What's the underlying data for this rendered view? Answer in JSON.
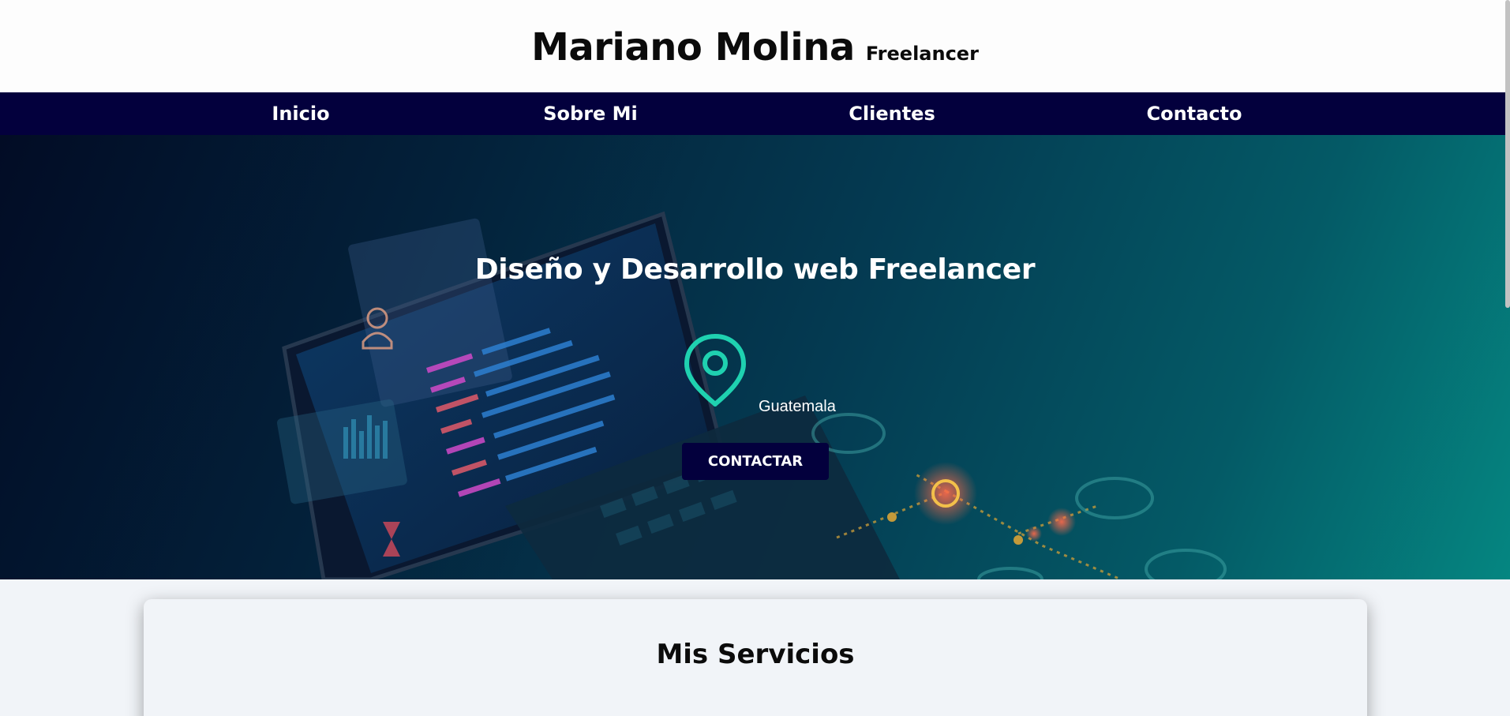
{
  "header": {
    "name": "Mariano Molina",
    "tagline": "Freelancer"
  },
  "nav": {
    "items": [
      {
        "label": "Inicio"
      },
      {
        "label": "Sobre Mi"
      },
      {
        "label": "Clientes"
      },
      {
        "label": "Contacto"
      }
    ]
  },
  "hero": {
    "title": "Diseño y Desarrollo web Freelancer",
    "location": "Guatemala",
    "location_icon": "map-pin-icon",
    "cta_label": "CONTACTAR",
    "background_image": "laptop with code and circuit illustration"
  },
  "services": {
    "title": "Mis Servicios"
  },
  "colors": {
    "nav_bg": "#03003d",
    "accent_teal": "#1fd1b0",
    "page_bg": "#f1f4f8"
  }
}
